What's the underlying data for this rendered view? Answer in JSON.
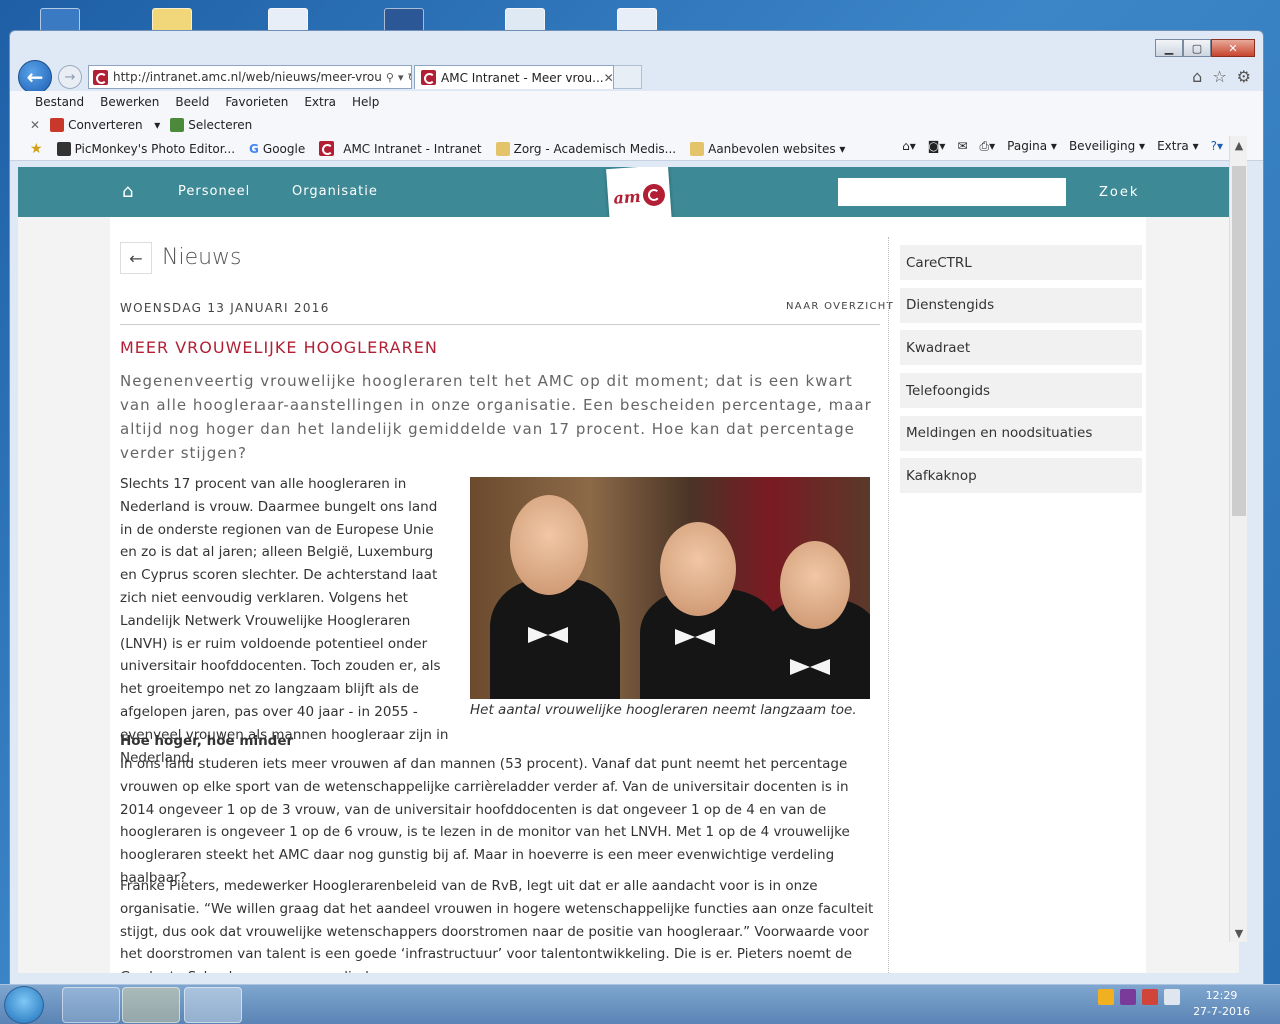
{
  "browser": {
    "url": "http://intranet.amc.nl/web/nieuws/meer-vrou",
    "tab_title": "AMC Intranet - Meer vrou...",
    "tab_close": "✕",
    "menu": [
      "Bestand",
      "Bewerken",
      "Beeld",
      "Favorieten",
      "Extra",
      "Help"
    ],
    "command": {
      "converteren": "Converteren",
      "selecteren": "Selecteren"
    },
    "favorites": [
      {
        "label": "PicMonkey's Photo Editor...",
        "icon": "picmonkey-icon"
      },
      {
        "label": "Google",
        "icon": "google-icon"
      },
      {
        "label": "AMC Intranet - Intranet",
        "icon": "amc-icon"
      },
      {
        "label": "Zorg - Academisch Medis...",
        "icon": "page-icon"
      },
      {
        "label": "Aanbevolen websites ▾",
        "icon": "page-icon"
      }
    ],
    "right_commands": [
      "Pagina ▾",
      "Beveiliging ▾",
      "Extra ▾"
    ]
  },
  "site": {
    "nav": [
      "Personeel",
      "Organisatie"
    ],
    "logo_text": "am",
    "search_button": "Zoek"
  },
  "article": {
    "section": "Nieuws",
    "date": "WOENSDAG 13 JANUARI 2016",
    "overview_link": "NAAR OVERZICHT",
    "title": "MEER VROUWELIJKE HOOGLERAREN",
    "lead": "Negenenveertig vrouwelijke hoogleraren telt het AMC op dit moment; dat is een kwart van alle hoogleraar-aanstellingen in onze organisatie. Een bescheiden percentage, maar altijd nog hoger dan het landelijk gemiddelde van 17 procent. Hoe kan dat percentage verder stijgen?",
    "p1": "Slechts 17 procent van alle hoogleraren in Nederland is vrouw. Daarmee bungelt ons land in de onderste regionen van de Europese Unie en zo is dat al jaren; alleen België, Luxemburg en Cyprus scoren slechter. De achterstand laat zich niet eenvoudig verklaren. Volgens het Landelijk Netwerk Vrouwelijke Hoogleraren (LNVH) is er ruim voldoende potentieel onder universitair hoofddocenten. Toch zouden er, als het groeitempo net zo langzaam blijft als de afgelopen jaren, pas over 40 jaar - in 2055 - evenveel vrouwen als mannen hoogleraar zijn in Nederland.",
    "caption": "Het aantal vrouwelijke hoogleraren neemt langzaam toe.",
    "h2": "Hoe hoger, hoe minder",
    "p2": "In ons land studeren iets meer vrouwen af dan mannen (53 procent). Vanaf dat punt neemt het percentage vrouwen op elke sport van de wetenschappelijke carrièreladder verder af. Van de universitair docenten is in 2014 ongeveer 1 op de 3 vrouw, van de universitair hoofddocenten is dat ongeveer 1 op de 4 en van de hoogleraren is ongeveer 1 op de 6 vrouw, is te lezen in de monitor van het LNVH. Met 1 op de 4 vrouwelijke hoogleraren steekt het AMC daar nog gunstig bij af. Maar in hoeverre is een meer evenwichtige verdeling haalbaar?",
    "p3": "Franke Pieters, medewerker Hooglerarenbeleid van de RvB, legt uit dat er alle aandacht voor is in onze organisatie. “We willen graag dat het aandeel vrouwen in hogere wetenschappelijke functies aan onze faculteit stijgt, dus ook dat vrouwelijke wetenschappers doorstromen naar de positie van hoogleraar.” Voorwaarde voor het doorstromen van talent is een goede ‘infrastructuur’ voor talentontwikkeling. Die is er. Pieters noemt de Graduate School voor promovendi, de"
  },
  "sidebar": [
    "CareCTRL",
    "Dienstengids",
    "Kwadraet",
    "Telefoongids",
    "Meldingen en noodsituaties",
    "Kafkaknop"
  ],
  "taskbar": {
    "time": "12:29",
    "date": "27-7-2016"
  },
  "colors": {
    "header": "#3d8a96",
    "accent": "#b21f35"
  }
}
